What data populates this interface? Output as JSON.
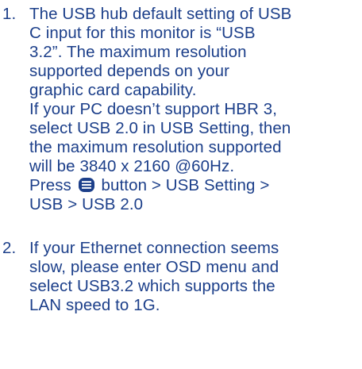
{
  "notes": [
    {
      "number": "1.",
      "lines": [
        "The USB hub default setting of USB",
        "C input for this monitor is “USB",
        "3.2”. The maximum resolution",
        "supported depends on your",
        "graphic card capability.",
        "If your PC doesn’t support HBR 3,",
        "select USB 2.0 in USB Setting, then",
        "the maximum resolution supported",
        "will be 3840 x 2160 @60Hz."
      ],
      "instruction_prefix": "Press",
      "instruction_icon": "menu-button-icon",
      "instruction_suffix": "button > USB Setting >",
      "instruction_line2": "USB > USB 2.0"
    },
    {
      "number": "2.",
      "lines": [
        "If your Ethernet connection seems",
        "slow, please enter OSD menu and",
        "select USB3.2 which supports the",
        "LAN speed to 1G."
      ]
    }
  ],
  "colors": {
    "text": "#1c3f8a",
    "background": "#ffffff"
  }
}
